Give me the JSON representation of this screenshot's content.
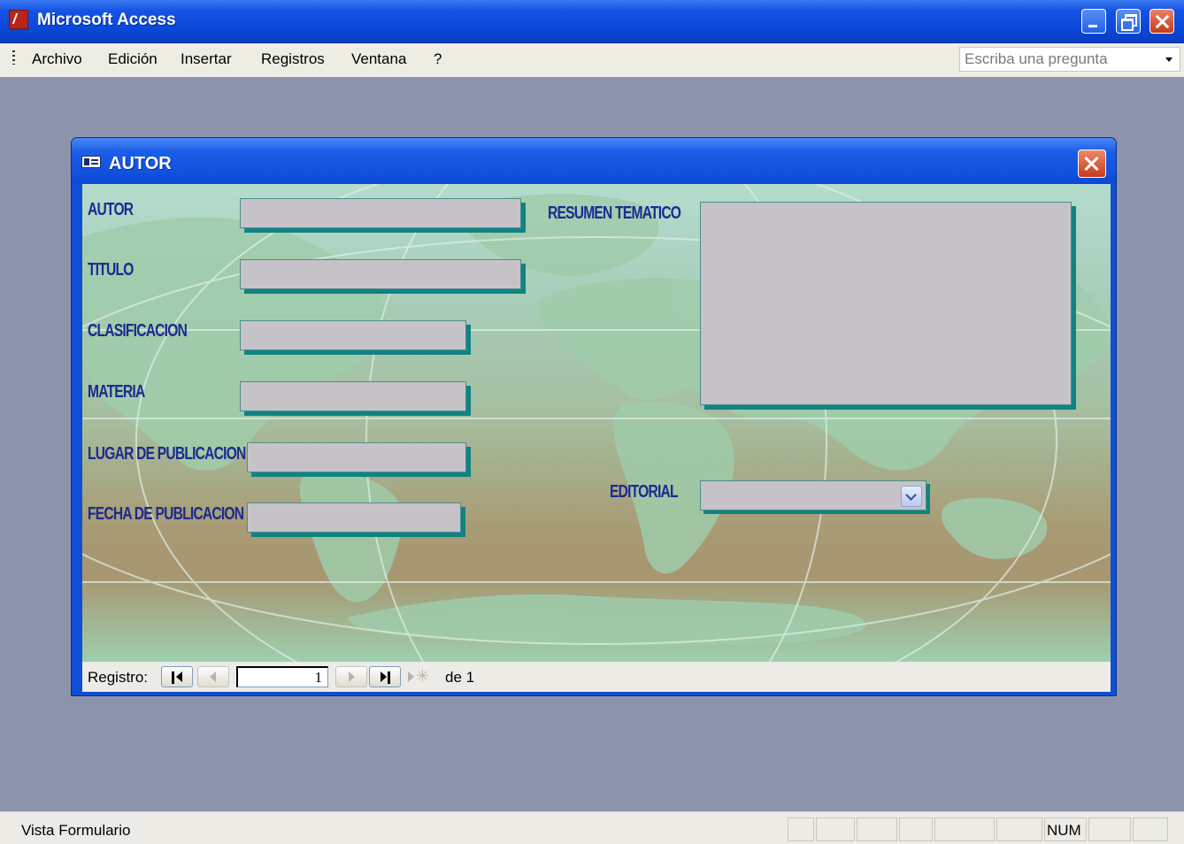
{
  "app": {
    "title": "Microsoft Access"
  },
  "menu": {
    "items": [
      "Archivo",
      "Edición",
      "Insertar",
      "Registros",
      "Ventana",
      "?"
    ],
    "help_placeholder": "Escriba una pregunta"
  },
  "form": {
    "title": "AUTOR",
    "labels": {
      "autor": "AUTOR",
      "titulo": "TITULO",
      "clasificacion": "CLASIFICACION",
      "materia": "MATERIA",
      "lugar": "LUGAR DE PUBLICACION",
      "fecha": "FECHA DE PUBLICACION",
      "resumen": "RESUMEN TEMATICO",
      "editorial": "EDITORIAL"
    },
    "values": {
      "autor": "",
      "titulo": "",
      "clasificacion": "",
      "materia": "",
      "lugar": "",
      "fecha": "",
      "resumen": "",
      "editorial": ""
    }
  },
  "navigation": {
    "label": "Registro:",
    "current": "1",
    "of_text": "de 1"
  },
  "status": {
    "text": "Vista Formulario",
    "num": "NUM"
  },
  "colors": {
    "titlebar": "#0a47d8",
    "label_text": "#1d2a8f",
    "field_bg": "#c5c3c7",
    "field_shadow": "#108383",
    "desktop": "#8c93ab"
  }
}
